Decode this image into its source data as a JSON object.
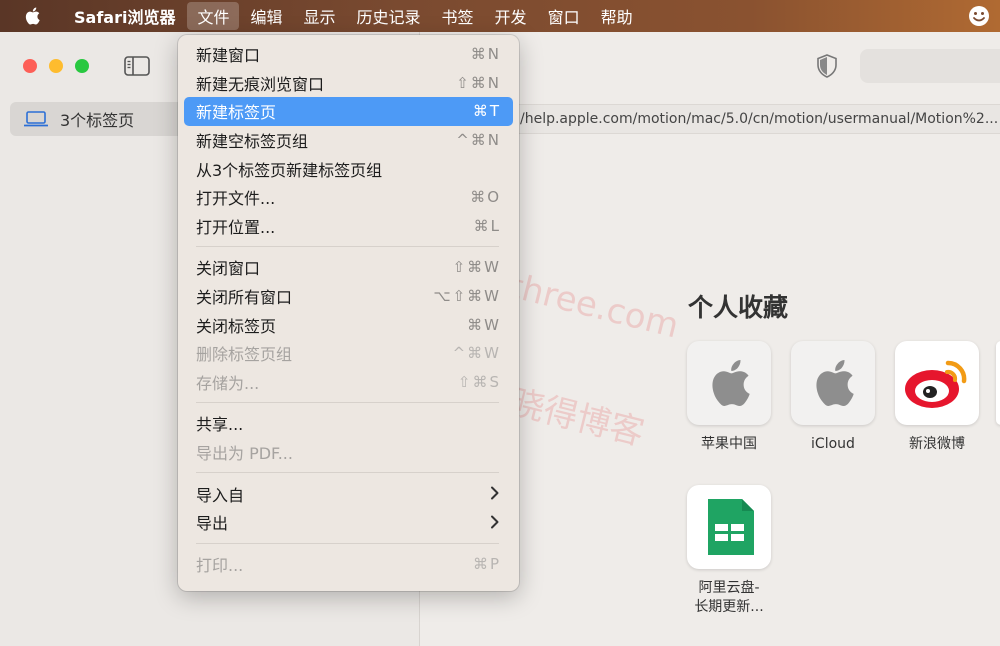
{
  "menubar": {
    "app_name": "Safari浏览器",
    "items": [
      "文件",
      "编辑",
      "显示",
      "历史记录",
      "书签",
      "开发",
      "窗口",
      "帮助"
    ]
  },
  "sidebar": {
    "tab_group_label": "3个标签页"
  },
  "url_text": "/help.apple.com/motion/mac/5.0/cn/motion/usermanual/Motion%2...",
  "favorites": {
    "title": "个人收藏",
    "items": [
      {
        "label": "苹果中国"
      },
      {
        "label": "iCloud"
      },
      {
        "label": "新浪微博"
      },
      {
        "label_line1": "阿里云盘-",
        "label_line2": "长期更新..."
      }
    ]
  },
  "watermark": {
    "url": "https://www.pythonthree.com",
    "cn": "晓得博客"
  },
  "file_menu": {
    "items": [
      {
        "label": "新建窗口",
        "shortcut": "⌘N"
      },
      {
        "label": "新建无痕浏览窗口",
        "shortcut": "⇧⌘N"
      },
      {
        "label": "新建标签页",
        "shortcut": "⌘T"
      },
      {
        "label": "新建空标签页组",
        "shortcut": "^⌘N"
      },
      {
        "label": "从3个标签页新建标签页组",
        "shortcut": ""
      },
      {
        "label": "打开文件...",
        "shortcut": "⌘O"
      },
      {
        "label": "打开位置...",
        "shortcut": "⌘L"
      },
      {
        "label": "关闭窗口",
        "shortcut": "⇧⌘W"
      },
      {
        "label": "关闭所有窗口",
        "shortcut": "⌥⇧⌘W"
      },
      {
        "label": "关闭标签页",
        "shortcut": "⌘W"
      },
      {
        "label": "删除标签页组",
        "shortcut": "^⌘W"
      },
      {
        "label": "存储为...",
        "shortcut": "⇧⌘S"
      },
      {
        "label": "共享...",
        "shortcut": ""
      },
      {
        "label": "导出为 PDF...",
        "shortcut": ""
      },
      {
        "label": "导入自",
        "shortcut": ""
      },
      {
        "label": "导出",
        "shortcut": ""
      },
      {
        "label": "打印...",
        "shortcut": "⌘P"
      }
    ]
  },
  "colors": {
    "highlight": "#4d9af6",
    "close": "#fd5f57",
    "minimize": "#febc2e",
    "maximize": "#28c840",
    "numbers_green": "#1fa463",
    "weibo_red": "#e6162d"
  }
}
